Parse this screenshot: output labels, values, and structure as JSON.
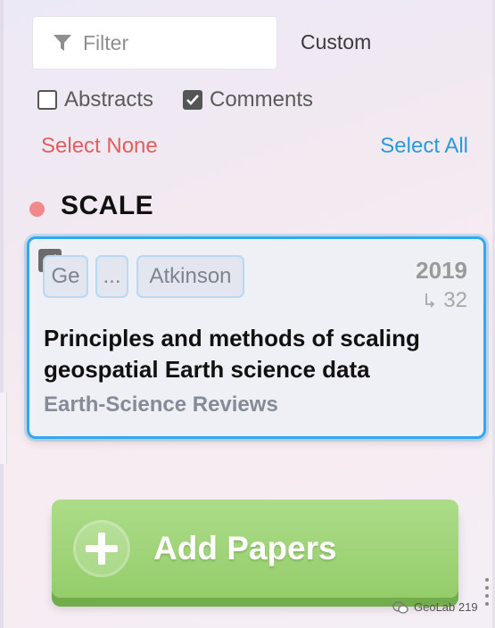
{
  "filter": {
    "placeholder": "Filter",
    "mode_label": "Custom"
  },
  "options": [
    {
      "label": "Abstracts",
      "checked": false
    },
    {
      "label": "Comments",
      "checked": true
    }
  ],
  "selection": {
    "select_none": "Select None",
    "select_all": "Select All"
  },
  "group": {
    "title": "SCALE",
    "dot_color": "#f08989"
  },
  "paper": {
    "selected": true,
    "authors": [
      "Ge",
      "...",
      "Atkinson"
    ],
    "year": "2019",
    "citations": "32",
    "title": "Principles and methods of scaling geospatial Earth science data",
    "journal": "Earth-Science Reviews"
  },
  "add_button": {
    "label": "Add Papers"
  },
  "watermark": {
    "text": "GeoLab 219"
  },
  "colors": {
    "accent_blue": "#2a9bd8",
    "select_none_red": "#e06060",
    "card_border": "#34a8ef",
    "button_green": "#9fd476"
  }
}
